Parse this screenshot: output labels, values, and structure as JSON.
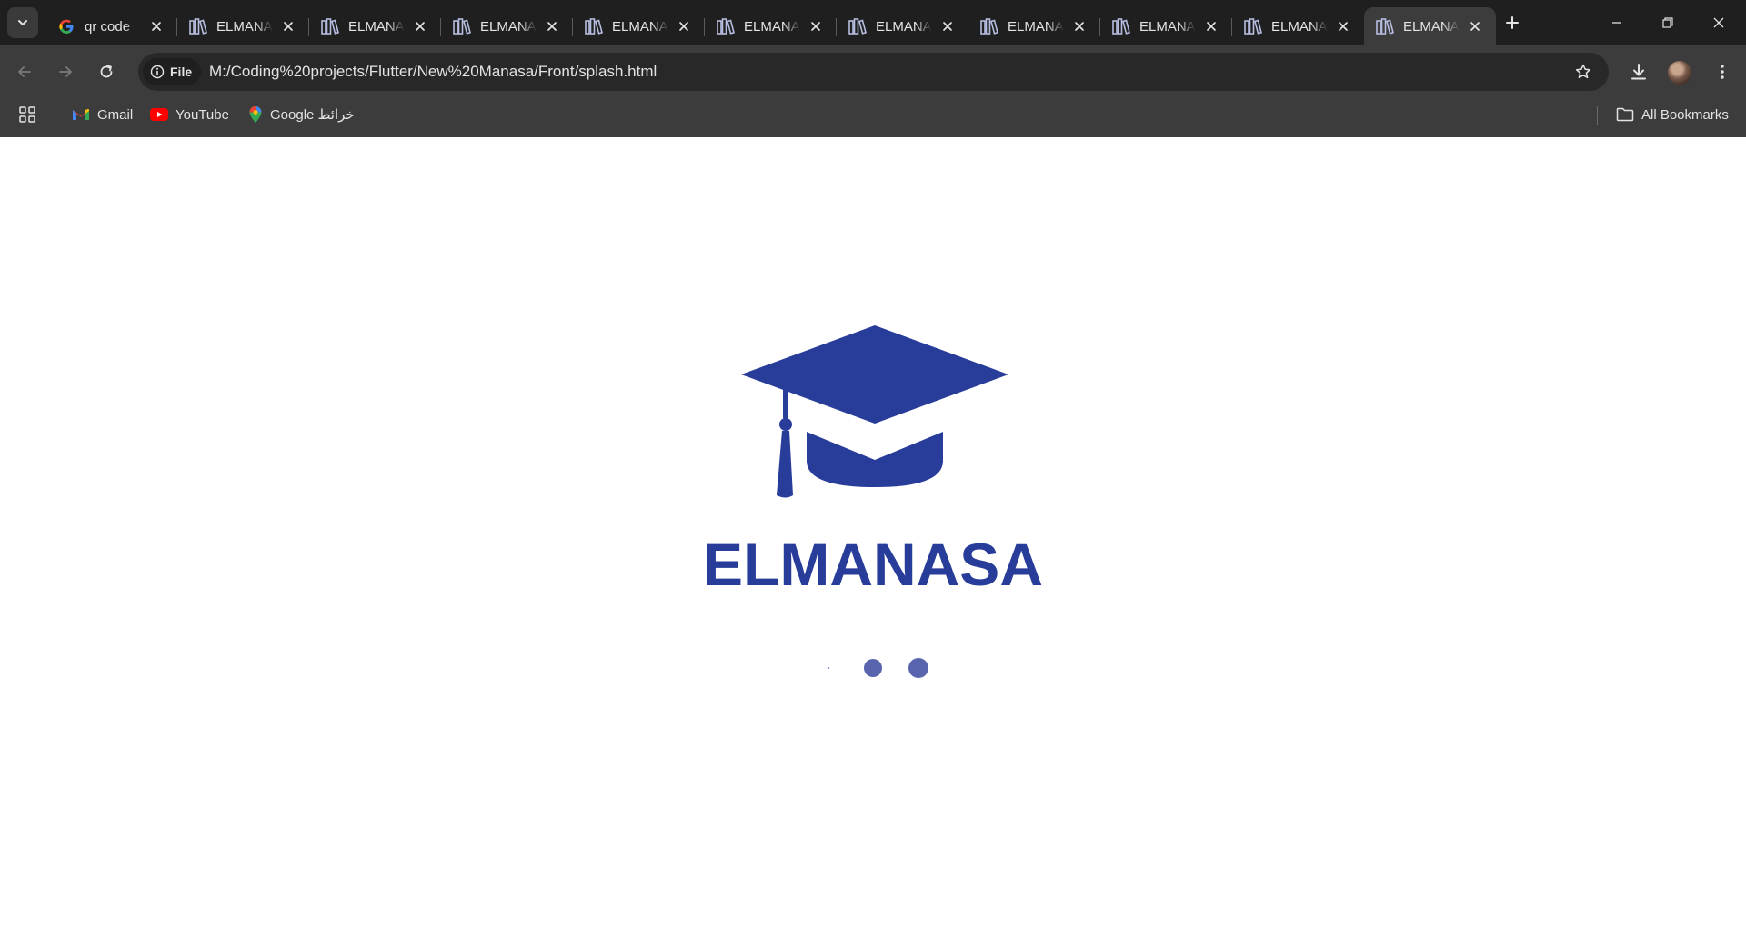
{
  "browser": {
    "tabs": [
      {
        "title": "qr code",
        "favicon": "google-g-icon",
        "active": false
      },
      {
        "title": "ELMANASA",
        "favicon": "books-icon",
        "active": false
      },
      {
        "title": "ELMANASA",
        "favicon": "books-icon",
        "active": false
      },
      {
        "title": "ELMANASA",
        "favicon": "books-icon",
        "active": false
      },
      {
        "title": "ELMANASA",
        "favicon": "books-icon",
        "active": false
      },
      {
        "title": "ELMANASA",
        "favicon": "books-icon",
        "active": false
      },
      {
        "title": "ELMANASA",
        "favicon": "books-icon",
        "active": false
      },
      {
        "title": "ELMANASA",
        "favicon": "books-icon",
        "active": false
      },
      {
        "title": "ELMANASA",
        "favicon": "books-icon",
        "active": false
      },
      {
        "title": "ELMANASA",
        "favicon": "books-icon",
        "active": false
      },
      {
        "title": "ELMANASA",
        "favicon": "books-icon",
        "active": true
      }
    ],
    "toolbar": {
      "site_chip_label": "File",
      "url": "M:/Coding%20projects/Flutter/New%20Manasa/Front/splash.html"
    },
    "bookmarks": {
      "items": [
        {
          "label": "Gmail",
          "icon": "gmail-icon"
        },
        {
          "label": "YouTube",
          "icon": "youtube-icon"
        },
        {
          "label": "Google خرائط",
          "icon": "google-maps-icon"
        }
      ],
      "all_bookmarks_label": "All Bookmarks"
    }
  },
  "page": {
    "logo_icon": "graduation-cap-icon",
    "brand_title": "ELMANASA",
    "brand_color": "#283c9a",
    "dot_color": "#5864ae"
  }
}
